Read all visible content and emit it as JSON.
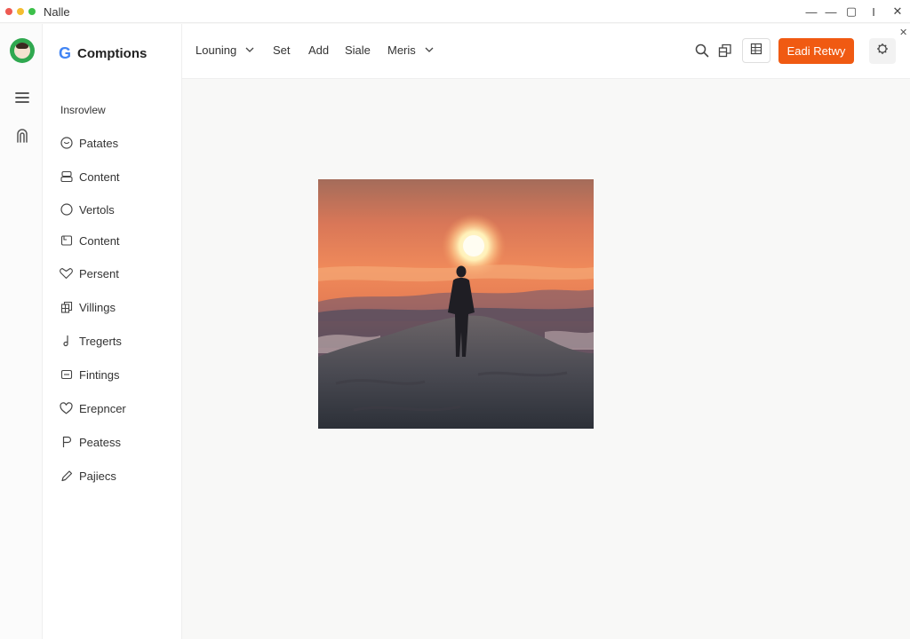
{
  "window": {
    "title": "Nalle",
    "controls": [
      "—",
      "—",
      "▢",
      "I",
      "✕"
    ]
  },
  "brand": {
    "name": "Comptions"
  },
  "sidebar": {
    "heading": "Insrovlew",
    "items": [
      {
        "label": "Patates",
        "icon": "smile-icon"
      },
      {
        "label": "Content",
        "icon": "stack-icon"
      },
      {
        "label": "Vertols",
        "icon": "circle-icon"
      },
      {
        "label": "Content",
        "icon": "folder-icon"
      },
      {
        "label": "Persent",
        "icon": "heart-outline-icon"
      },
      {
        "label": "Villings",
        "icon": "layers-icon"
      },
      {
        "label": "Tregerts",
        "icon": "music-note-icon"
      },
      {
        "label": "Fintings",
        "icon": "card-icon"
      },
      {
        "label": "Erepncer",
        "icon": "heart-icon"
      },
      {
        "label": "Peatess",
        "icon": "flag-icon"
      },
      {
        "label": "Pajiecs",
        "icon": "pen-icon"
      }
    ]
  },
  "toolbar": {
    "menus": [
      {
        "label": "Louning",
        "dropdown": true
      },
      {
        "label": "Set",
        "dropdown": false
      },
      {
        "label": "Add",
        "dropdown": false
      },
      {
        "label": "Siale",
        "dropdown": false
      },
      {
        "label": "Meris",
        "dropdown": true
      }
    ],
    "primary_button": "Eadi Retwy"
  },
  "colors": {
    "accent": "#f05a12",
    "avatar_bg": "#2fa84f"
  },
  "image": {
    "subject": "sunset-silhouette-photo"
  }
}
